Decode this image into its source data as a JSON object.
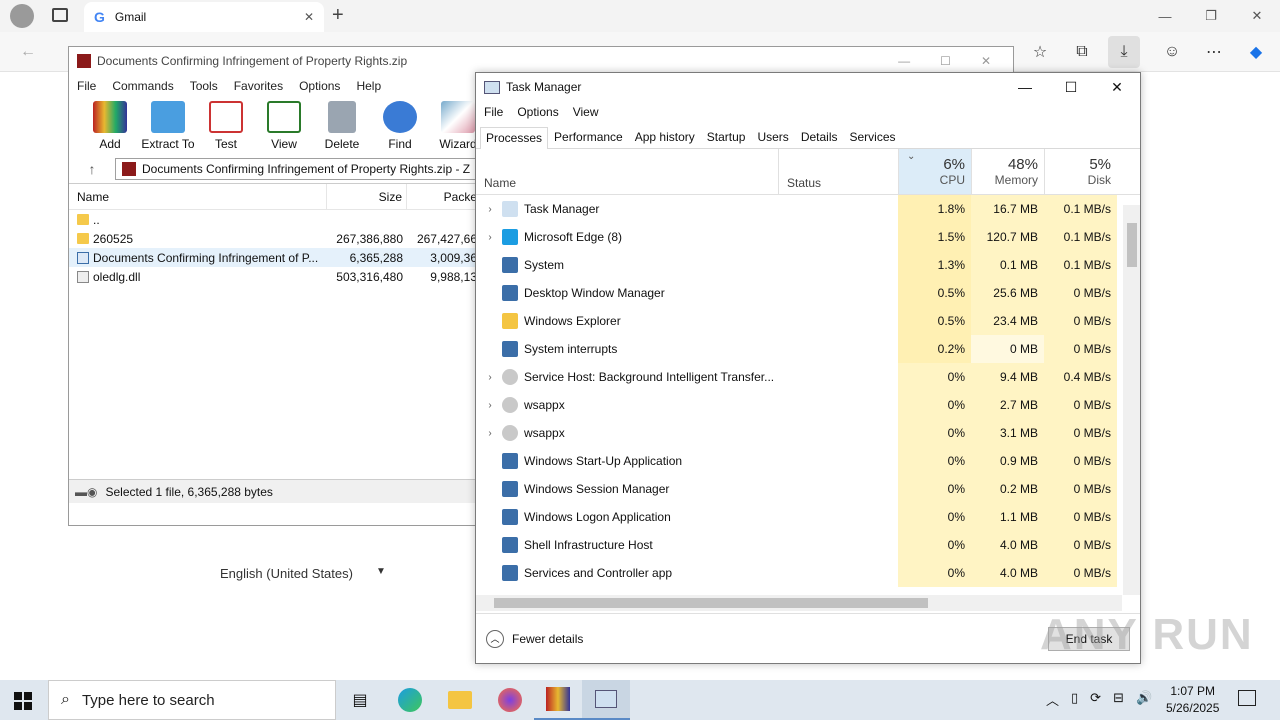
{
  "browser": {
    "tab_title": "Gmail",
    "tab_logo": "G",
    "new_tab": "+"
  },
  "gmail": {
    "language": "English (United States)"
  },
  "winrar": {
    "title": "Documents Confirming Infringement of Property Rights.zip",
    "menu": [
      "File",
      "Commands",
      "Tools",
      "Favorites",
      "Options",
      "Help"
    ],
    "toolbar": [
      "Add",
      "Extract To",
      "Test",
      "View",
      "Delete",
      "Find",
      "Wizard"
    ],
    "address": "Documents Confirming Infringement of Property Rights.zip - Z",
    "columns": {
      "name": "Name",
      "size": "Size",
      "packed": "Packe"
    },
    "rows": [
      {
        "name": "..",
        "size": "",
        "packed": "",
        "type": "folder"
      },
      {
        "name": "260525",
        "size": "267,386,880",
        "packed": "267,427,66",
        "type": "folder"
      },
      {
        "name": "Documents Confirming Infringement of P...",
        "size": "6,365,288",
        "packed": "3,009,36",
        "type": "file"
      },
      {
        "name": "oledlg.dll",
        "size": "503,316,480",
        "packed": "9,988,13",
        "type": "file"
      }
    ],
    "status": "Selected 1 file, 6,365,288 bytes"
  },
  "taskmgr": {
    "title": "Task Manager",
    "menu": [
      "File",
      "Options",
      "View"
    ],
    "tabs": [
      "Processes",
      "Performance",
      "App history",
      "Startup",
      "Users",
      "Details",
      "Services"
    ],
    "hdr": {
      "name": "Name",
      "status": "Status",
      "cpu_pct": "6%",
      "cpu": "CPU",
      "mem_pct": "48%",
      "mem": "Memory",
      "disk_pct": "5%",
      "disk": "Disk"
    },
    "rows": [
      {
        "name": "Task Manager",
        "exp": "›",
        "cpu": "1.8%",
        "mem": "16.7 MB",
        "disk": "0.1 MB/s"
      },
      {
        "name": "Microsoft Edge (8)",
        "exp": "›",
        "cpu": "1.5%",
        "mem": "120.7 MB",
        "disk": "0.1 MB/s"
      },
      {
        "name": "System",
        "exp": "",
        "cpu": "1.3%",
        "mem": "0.1 MB",
        "disk": "0.1 MB/s"
      },
      {
        "name": "Desktop Window Manager",
        "exp": "",
        "cpu": "0.5%",
        "mem": "25.6 MB",
        "disk": "0 MB/s"
      },
      {
        "name": "Windows Explorer",
        "exp": "",
        "cpu": "0.5%",
        "mem": "23.4 MB",
        "disk": "0 MB/s"
      },
      {
        "name": "System interrupts",
        "exp": "",
        "cpu": "0.2%",
        "mem": "0 MB",
        "disk": "0 MB/s"
      },
      {
        "name": "Service Host: Background Intelligent Transfer...",
        "exp": "›",
        "cpu": "0%",
        "mem": "9.4 MB",
        "disk": "0.4 MB/s"
      },
      {
        "name": "wsappx",
        "exp": "›",
        "cpu": "0%",
        "mem": "2.7 MB",
        "disk": "0 MB/s"
      },
      {
        "name": "wsappx",
        "exp": "›",
        "cpu": "0%",
        "mem": "3.1 MB",
        "disk": "0 MB/s"
      },
      {
        "name": "Windows Start-Up Application",
        "exp": "",
        "cpu": "0%",
        "mem": "0.9 MB",
        "disk": "0 MB/s"
      },
      {
        "name": "Windows Session Manager",
        "exp": "",
        "cpu": "0%",
        "mem": "0.2 MB",
        "disk": "0 MB/s"
      },
      {
        "name": "Windows Logon Application",
        "exp": "",
        "cpu": "0%",
        "mem": "1.1 MB",
        "disk": "0 MB/s"
      },
      {
        "name": "Shell Infrastructure Host",
        "exp": "",
        "cpu": "0%",
        "mem": "4.0 MB",
        "disk": "0 MB/s"
      },
      {
        "name": "Services and Controller app",
        "exp": "",
        "cpu": "0%",
        "mem": "4.0 MB",
        "disk": "0 MB/s"
      }
    ],
    "fewer": "Fewer details",
    "end_task": "End task"
  },
  "taskbar": {
    "search": "Type here to search",
    "time": "1:07 PM",
    "date": "5/26/2025"
  },
  "watermark": "ANY RUN",
  "colors": {
    "cpu_hi": "#fff0b3",
    "cpu_lo": "#fff4c4",
    "metric_bg": "#fff4c4"
  }
}
